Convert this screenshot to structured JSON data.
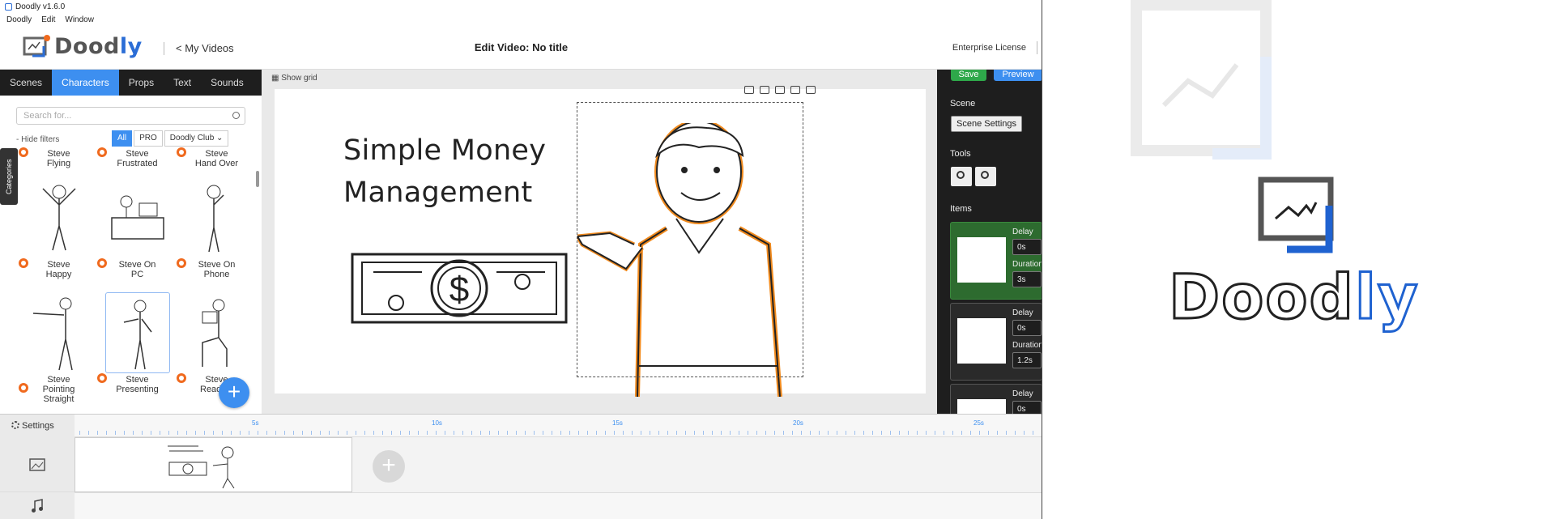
{
  "window": {
    "title": "Doodly v1.6.0"
  },
  "menu": [
    "Doodly",
    "Edit",
    "Window"
  ],
  "header": {
    "logo_text_a": "Dood",
    "logo_text_b": "ly",
    "back_link": "< My Videos",
    "title": "Edit Video: No title",
    "license": "Enterprise License"
  },
  "tabs": [
    "Scenes",
    "Characters",
    "Props",
    "Text",
    "Sounds"
  ],
  "active_tab": "Characters",
  "search": {
    "placeholder": "Search for..."
  },
  "filters": {
    "hide_label": "- Hide filters",
    "options": [
      "All",
      "PRO",
      "Doodly Club ⌄"
    ]
  },
  "categories_label": "Categories",
  "characters": [
    {
      "name": "Steve\nFlying"
    },
    {
      "name": "Steve\nFrustrated"
    },
    {
      "name": "Steve\nHand Over"
    },
    {
      "name": "Steve\nHappy"
    },
    {
      "name": "Steve On\nPC"
    },
    {
      "name": "Steve On\nPhone"
    },
    {
      "name": "Steve\nPointing\nStraight"
    },
    {
      "name": "Steve\nPresenting"
    },
    {
      "name": "Steve\nReading"
    }
  ],
  "canvas": {
    "show_grid": "Show grid",
    "text_line1": "Simple Money",
    "text_line2": "Management"
  },
  "right_panel": {
    "save": "Save",
    "preview": "Preview",
    "scene_label": "Scene",
    "scene_settings": "Scene Settings",
    "tools_label": "Tools",
    "items_label": "Items",
    "items": [
      {
        "delay_label": "Delay",
        "delay": "0s",
        "duration_label": "Duration",
        "duration": "3s"
      },
      {
        "delay_label": "Delay",
        "delay": "0s",
        "duration_label": "Duration",
        "duration": "1.2s"
      },
      {
        "delay_label": "Delay",
        "delay": "0s"
      }
    ]
  },
  "timeline": {
    "settings": "Settings",
    "ruler_labels": [
      "5s",
      "10s",
      "15s",
      "20s",
      "25s"
    ]
  },
  "brand": {
    "word_a": "Dood",
    "word_b": "ly"
  },
  "colors": {
    "accent": "#3d8ff0",
    "save": "#2ea84a",
    "brand_blue": "#1f62d0",
    "star": "#f06a1e",
    "selected_item": "#2d6b2f"
  }
}
